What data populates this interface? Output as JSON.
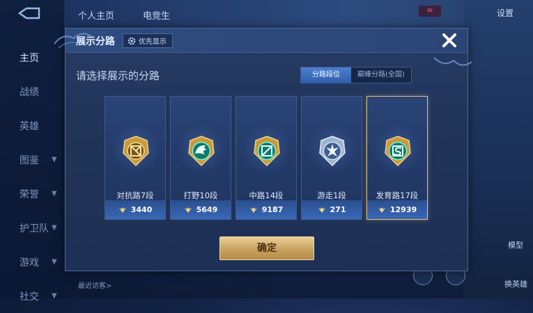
{
  "background": {
    "top_tabs": [
      "个人主页",
      "电竞生"
    ],
    "settings_label": "设置",
    "side_nav": [
      {
        "label": "主页",
        "active": true,
        "chevron": false
      },
      {
        "label": "战绩",
        "active": false,
        "chevron": false
      },
      {
        "label": "英雄",
        "active": false,
        "chevron": false
      },
      {
        "label": "图鉴",
        "active": false,
        "chevron": true
      },
      {
        "label": "荣誉",
        "active": false,
        "chevron": true
      },
      {
        "label": "护卫队",
        "active": false,
        "chevron": true
      },
      {
        "label": "游戏",
        "active": false,
        "chevron": true
      },
      {
        "label": "社交",
        "active": false,
        "chevron": true
      }
    ],
    "recent_visitors": "最近访客>",
    "model_label": "模型",
    "switch_hero_label": "换英雄"
  },
  "dialog": {
    "title": "展示分路",
    "priority_button": "优先显示",
    "subtitle": "请选择展示的分路",
    "segment": {
      "options": [
        "分路段位",
        "巅峰分路(全国)"
      ],
      "selected": 0
    },
    "cards": [
      {
        "rank": "对抗路7段",
        "score": "3440",
        "emblem": "clash-lane-emblem-gold",
        "selected": false
      },
      {
        "rank": "打野10段",
        "score": "5649",
        "emblem": "jungle-emblem-teal",
        "selected": false
      },
      {
        "rank": "中路14段",
        "score": "9187",
        "emblem": "mid-lane-emblem-teal",
        "selected": false
      },
      {
        "rank": "游走1段",
        "score": "271",
        "emblem": "roam-emblem-silver",
        "selected": false
      },
      {
        "rank": "发育路17段",
        "score": "12939",
        "emblem": "farm-lane-emblem-teal",
        "selected": true
      }
    ],
    "confirm_label": "确定"
  },
  "colors": {
    "accent_gold": "#e8c07a",
    "score_bar": "#3868b6",
    "dialog_bg": "#213459"
  }
}
